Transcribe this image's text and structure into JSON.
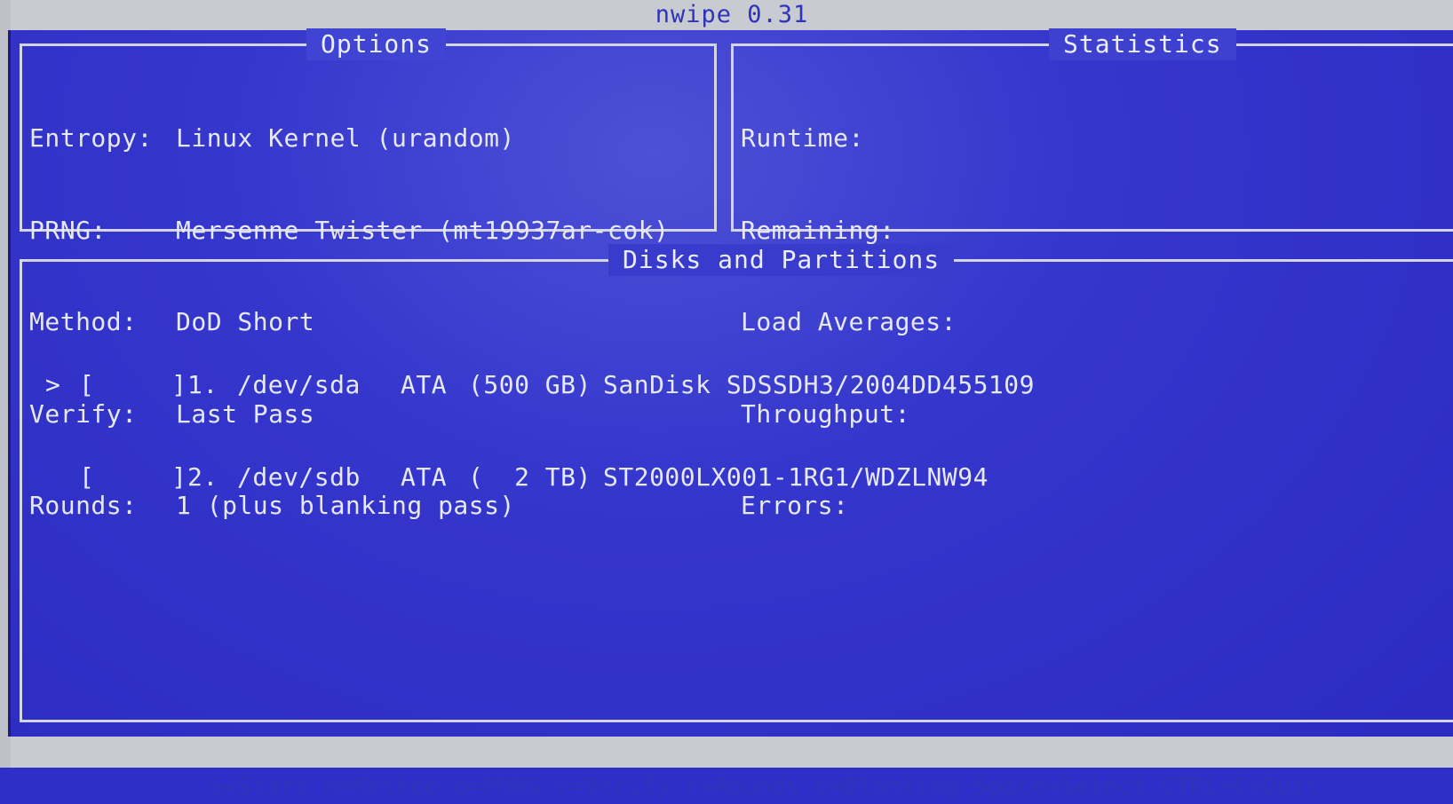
{
  "app": {
    "title": "nwipe 0.31"
  },
  "options": {
    "title": "Options",
    "rows": [
      {
        "label": "Entropy:",
        "value": "Linux Kernel (urandom)"
      },
      {
        "label": "PRNG:",
        "value": "Mersenne Twister (mt19937ar-cok)"
      },
      {
        "label": "Method:",
        "value": "DoD Short"
      },
      {
        "label": "Verify:",
        "value": "Last Pass"
      },
      {
        "label": "Rounds:",
        "value": "1 (plus blanking pass)"
      }
    ]
  },
  "statistics": {
    "title": "Statistics",
    "rows": [
      {
        "label": "Runtime:"
      },
      {
        "label": "Remaining:"
      },
      {
        "label": "Load Averages:"
      },
      {
        "label": "Throughput:"
      },
      {
        "label": "Errors:"
      }
    ]
  },
  "disks": {
    "title": "Disks and Partitions",
    "items": [
      {
        "cursor": ">",
        "checkbox": "[     ]",
        "index": "1.",
        "device": "/dev/sda",
        "bus": "ATA",
        "size": "(500 GB)",
        "model": "SanDisk SDSSDH3/2004DD455109"
      },
      {
        "cursor": "",
        "checkbox": "[     ]",
        "index": "2.",
        "device": "/dev/sdb",
        "bus": "ATA",
        "size": "(  2 TB)",
        "model": "ST2000LX001-1RG1/WDZLNW94"
      }
    ]
  },
  "footer": {
    "help": "S=Start m=Method p=PRNG v=Verify r=Rounds b=Blanking Space=Select CTRL+C=Quit"
  },
  "colors": {
    "background": "#2e2fc8",
    "bar": "#c9cbd3",
    "bar_text": "#2e33b8",
    "text": "#e6e8f2"
  }
}
